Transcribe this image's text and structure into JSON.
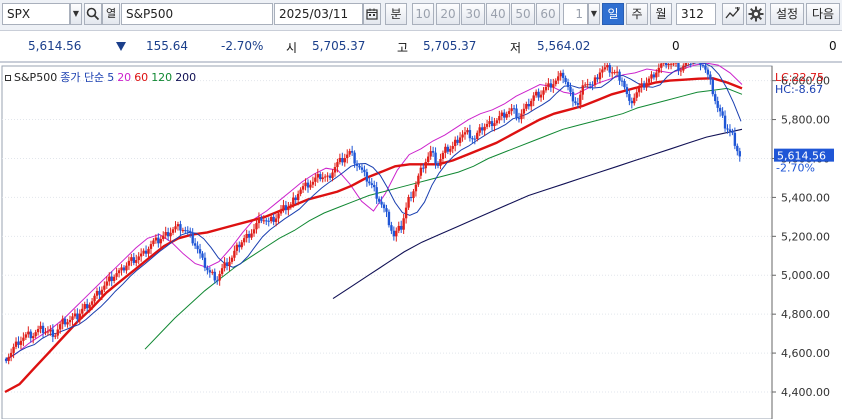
{
  "toolbar": {
    "symbol": "SPX",
    "symbol_caret": "▼",
    "search_icon": "magnifier",
    "open_label": "열",
    "name": "S&P500",
    "date": "2025/03/11",
    "calendar_icon": "calendar",
    "minute_label": "분",
    "period_buttons": [
      "10",
      "20",
      "30",
      "40",
      "50",
      "60"
    ],
    "period_select_value": "1",
    "day_label": "일",
    "week_label": "주",
    "month_label": "월",
    "bar_count": "312",
    "draw_icon": "trendline-tool",
    "settings_icon": "gear",
    "settings_label": "설정",
    "next_label": "다음",
    "colors": {
      "active_tab": "#2f6fd1"
    }
  },
  "quote": {
    "price": "5,614.56",
    "direction_icon": "down-triangle",
    "change": "155.64",
    "change_pct": "-2.70%",
    "open_label": "시",
    "open": "5,705.37",
    "high_label": "고",
    "high": "5,705.37",
    "low_label": "저",
    "low": "5,564.02",
    "volume": "0",
    "amount": "0"
  },
  "legend": {
    "title": "S&P500",
    "close_label": "종가 단순",
    "ma": [
      "5",
      "20",
      "60",
      "120",
      "200"
    ],
    "colors": [
      "#1a3fb0",
      "#cc22cc",
      "#dd1111",
      "#118833",
      "#111155"
    ]
  },
  "chart_data": {
    "type": "candlestick",
    "title": "S&P500",
    "y_ticks": [
      "6,000.00",
      "5,800.00",
      "5,600.00",
      "5,400.00",
      "5,200.00",
      "5,000.00",
      "4,800.00",
      "4,600.00",
      "4,400.00"
    ],
    "ylim": [
      4350,
      6230
    ],
    "last_price": "5,614.56",
    "last_change_pct": "-2.70%",
    "lc": "LC:22.75",
    "hc": "HC:-8.67",
    "close_series": [
      4567,
      4605,
      4662,
      4688,
      4695,
      4720,
      4707,
      4702,
      4760,
      4770,
      4790,
      4840,
      4870,
      4920,
      4960,
      5000,
      5020,
      5070,
      5090,
      5110,
      5160,
      5180,
      5210,
      5240,
      5250,
      5220,
      5160,
      5070,
      5010,
      4985,
      5050,
      5090,
      5160,
      5200,
      5240,
      5300,
      5270,
      5300,
      5340,
      5360,
      5430,
      5460,
      5480,
      5510,
      5500,
      5560,
      5600,
      5630,
      5570,
      5510,
      5460,
      5390,
      5310,
      5200,
      5250,
      5390,
      5470,
      5570,
      5630,
      5570,
      5640,
      5660,
      5720,
      5730,
      5700,
      5760,
      5780,
      5800,
      5830,
      5850,
      5810,
      5860,
      5920,
      5940,
      5970,
      6000,
      6030,
      5930,
      5880,
      6000,
      5970,
      6050,
      6060,
      6040,
      6010,
      5880,
      5940,
      5980,
      6020,
      6070,
      6100,
      6080,
      6060,
      6100,
      6120,
      6090,
      5990,
      5860,
      5770,
      5720,
      5614.56
    ],
    "ma_series": [
      {
        "name": "5",
        "color": "#1a3fb0"
      },
      {
        "name": "20",
        "color": "#cc22cc",
        "values": [
          4560,
          4600,
          4650,
          4690,
          4730,
          4780,
          4840,
          4900,
          4960,
          5020,
          5080,
          5140,
          5190,
          5210,
          5170,
          5110,
          5060,
          5040,
          5070,
          5140,
          5220,
          5290,
          5330,
          5380,
          5430,
          5480,
          5520,
          5550,
          5540,
          5470,
          5380,
          5330,
          5420,
          5540,
          5620,
          5650,
          5690,
          5720,
          5760,
          5800,
          5830,
          5850,
          5880,
          5920,
          5950,
          5980,
          5970,
          5940,
          5930,
          5960,
          5990,
          6010,
          6030,
          6040,
          6060,
          6050,
          6040,
          6060,
          6080,
          6090,
          6080,
          6040,
          5980
        ]
      },
      {
        "name": "60",
        "color": "#dd1111",
        "values": [
          4400,
          4440,
          4520,
          4600,
          4680,
          4760,
          4830,
          4910,
          4970,
          5030,
          5090,
          5150,
          5190,
          5210,
          5220,
          5240,
          5260,
          5280,
          5300,
          5330,
          5360,
          5390,
          5410,
          5430,
          5460,
          5500,
          5530,
          5560,
          5570,
          5570,
          5570,
          5590,
          5620,
          5650,
          5680,
          5720,
          5760,
          5800,
          5830,
          5850,
          5870,
          5900,
          5930,
          5950,
          5970,
          5990,
          6000,
          6005,
          6010,
          6012,
          5990,
          5960
        ]
      },
      {
        "name": "120",
        "color": "#118833",
        "values": [
          4620,
          4700,
          4780,
          4850,
          4920,
          4980,
          5040,
          5090,
          5140,
          5190,
          5230,
          5280,
          5320,
          5350,
          5380,
          5410,
          5430,
          5450,
          5470,
          5490,
          5510,
          5530,
          5560,
          5600,
          5630,
          5660,
          5690,
          5720,
          5750,
          5770,
          5790,
          5810,
          5830,
          5860,
          5880,
          5900,
          5920,
          5940,
          5950,
          5960,
          5930
        ]
      },
      {
        "name": "200",
        "color": "#111155",
        "values": [
          4880,
          4940,
          5000,
          5060,
          5120,
          5170,
          5210,
          5250,
          5290,
          5330,
          5370,
          5410,
          5440,
          5470,
          5500,
          5530,
          5560,
          5590,
          5620,
          5650,
          5680,
          5710,
          5730,
          5750
        ]
      }
    ],
    "grid": true,
    "legend_position": "top-left"
  }
}
